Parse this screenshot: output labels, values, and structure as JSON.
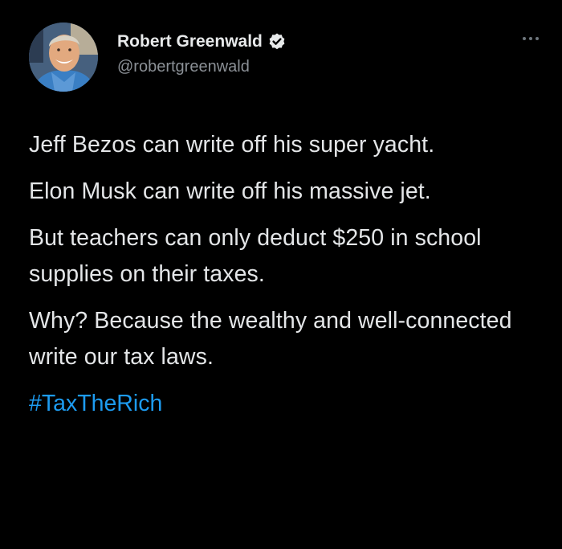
{
  "author": {
    "display_name": "Robert Greenwald",
    "handle": "@robertgreenwald",
    "verified": true,
    "avatar_icon": "person-avatar"
  },
  "tweet": {
    "paragraphs": [
      "Jeff Bezos can write off his super yacht.",
      "Elon Musk can write off his massive jet.",
      "But teachers can only deduct $250 in school supplies on their taxes.",
      "Why? Because the wealthy and well-connected write our tax laws."
    ],
    "hashtag": "#TaxTheRich"
  },
  "icons": {
    "more": "more-options-icon",
    "verified": "verified-badge-icon"
  },
  "colors": {
    "background": "#000000",
    "text": "#e7e9ea",
    "secondary_text": "#8b9096",
    "link": "#1d9bf0"
  }
}
